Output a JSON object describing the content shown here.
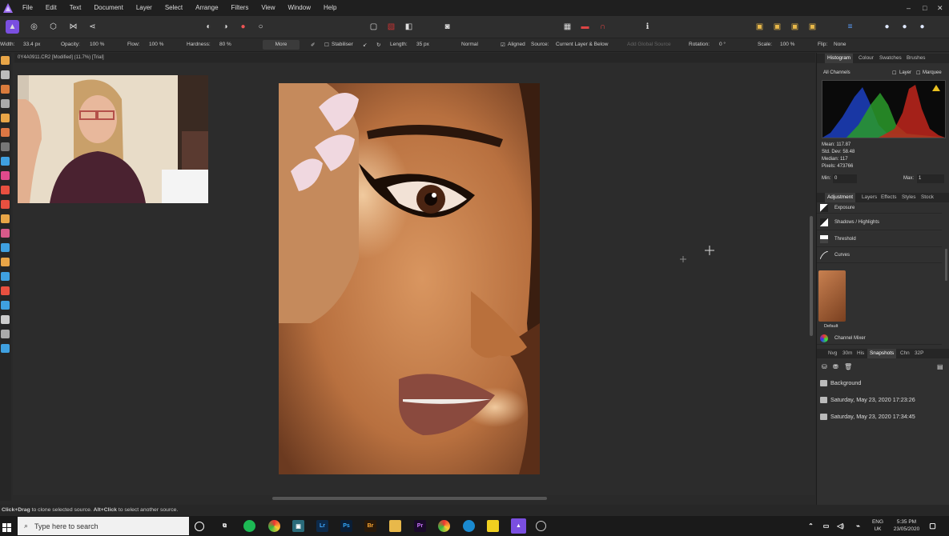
{
  "menubar": {
    "items": [
      "File",
      "Edit",
      "Text",
      "Document",
      "Layer",
      "Select",
      "Arrange",
      "Filters",
      "View",
      "Window",
      "Help"
    ],
    "window_controls": {
      "minimize": "–",
      "maximize": "□",
      "close": "✕"
    }
  },
  "context_bar": {
    "width_label": "Width:",
    "width_value": "33.4 px",
    "opacity_label": "Opacity:",
    "opacity_value": "100 %",
    "flow_label": "Flow:",
    "flow_value": "100 %",
    "hardness_label": "Hardness:",
    "hardness_value": "80 %",
    "more_label": "More",
    "stabiliser_label": "Stabiliser",
    "length_label": "Length:",
    "length_value": "35 px",
    "blend_mode": "Normal",
    "aligned_label": "Aligned",
    "source_label": "Source:",
    "source_value": "Current Layer & Below",
    "add_global_source": "Add Global Source",
    "rotation_label": "Rotation:",
    "rotation_value": "0 °",
    "scale_label": "Scale:",
    "scale_value": "100 %",
    "flip_label": "Flip:",
    "flip_value": "None"
  },
  "document": {
    "tab_title": "0Y4A0911.CR2 [Modified] (11.7%) [Trial]"
  },
  "status_bar": {
    "click_drag": "Click+Drag",
    "click_drag_desc": " to clone selected source. ",
    "alt_click": "Alt+Click",
    "alt_click_desc": " to select another source."
  },
  "right_panel": {
    "top_tabs": [
      "Histogram",
      "Colour",
      "Swatches",
      "Brushes"
    ],
    "histogram": {
      "channel": "All Channels",
      "layer_label": "Layer",
      "marquee_label": "Marquee",
      "mean": "Mean: 117.87",
      "std_dev": "Std. Dev: 58.48",
      "median": "Median: 117",
      "pixels": "Pixels: 473766",
      "min_label": "Min:",
      "min_value": "0",
      "max_label": "Max:",
      "max_value": "1"
    },
    "mid_tabs": [
      "Adjustment",
      "Layers",
      "Effects",
      "Styles",
      "Stock"
    ],
    "adjustments": [
      "Exposure",
      "Shadows / Highlights",
      "Threshold",
      "Curves"
    ],
    "preset_label": "Default",
    "channel_mixer": "Channel Mixer",
    "bottom_tabs": [
      "Nvg",
      "30m",
      "His",
      "Snapshots",
      "Chn",
      "32P"
    ],
    "snapshots": [
      "Background",
      "Saturday, May 23, 2020 17:23:26",
      "Saturday, May 23, 2020 17:34:45"
    ]
  },
  "taskbar": {
    "search_placeholder": "Type here to search",
    "language": "ENG",
    "region": "UK",
    "time": "5:35 PM",
    "date": "23/05/2020"
  },
  "colors": {
    "accent": "#8b5cf6",
    "hist_red": "#c0261c",
    "hist_green": "#2a9a2a",
    "hist_blue": "#1c3fc0"
  }
}
